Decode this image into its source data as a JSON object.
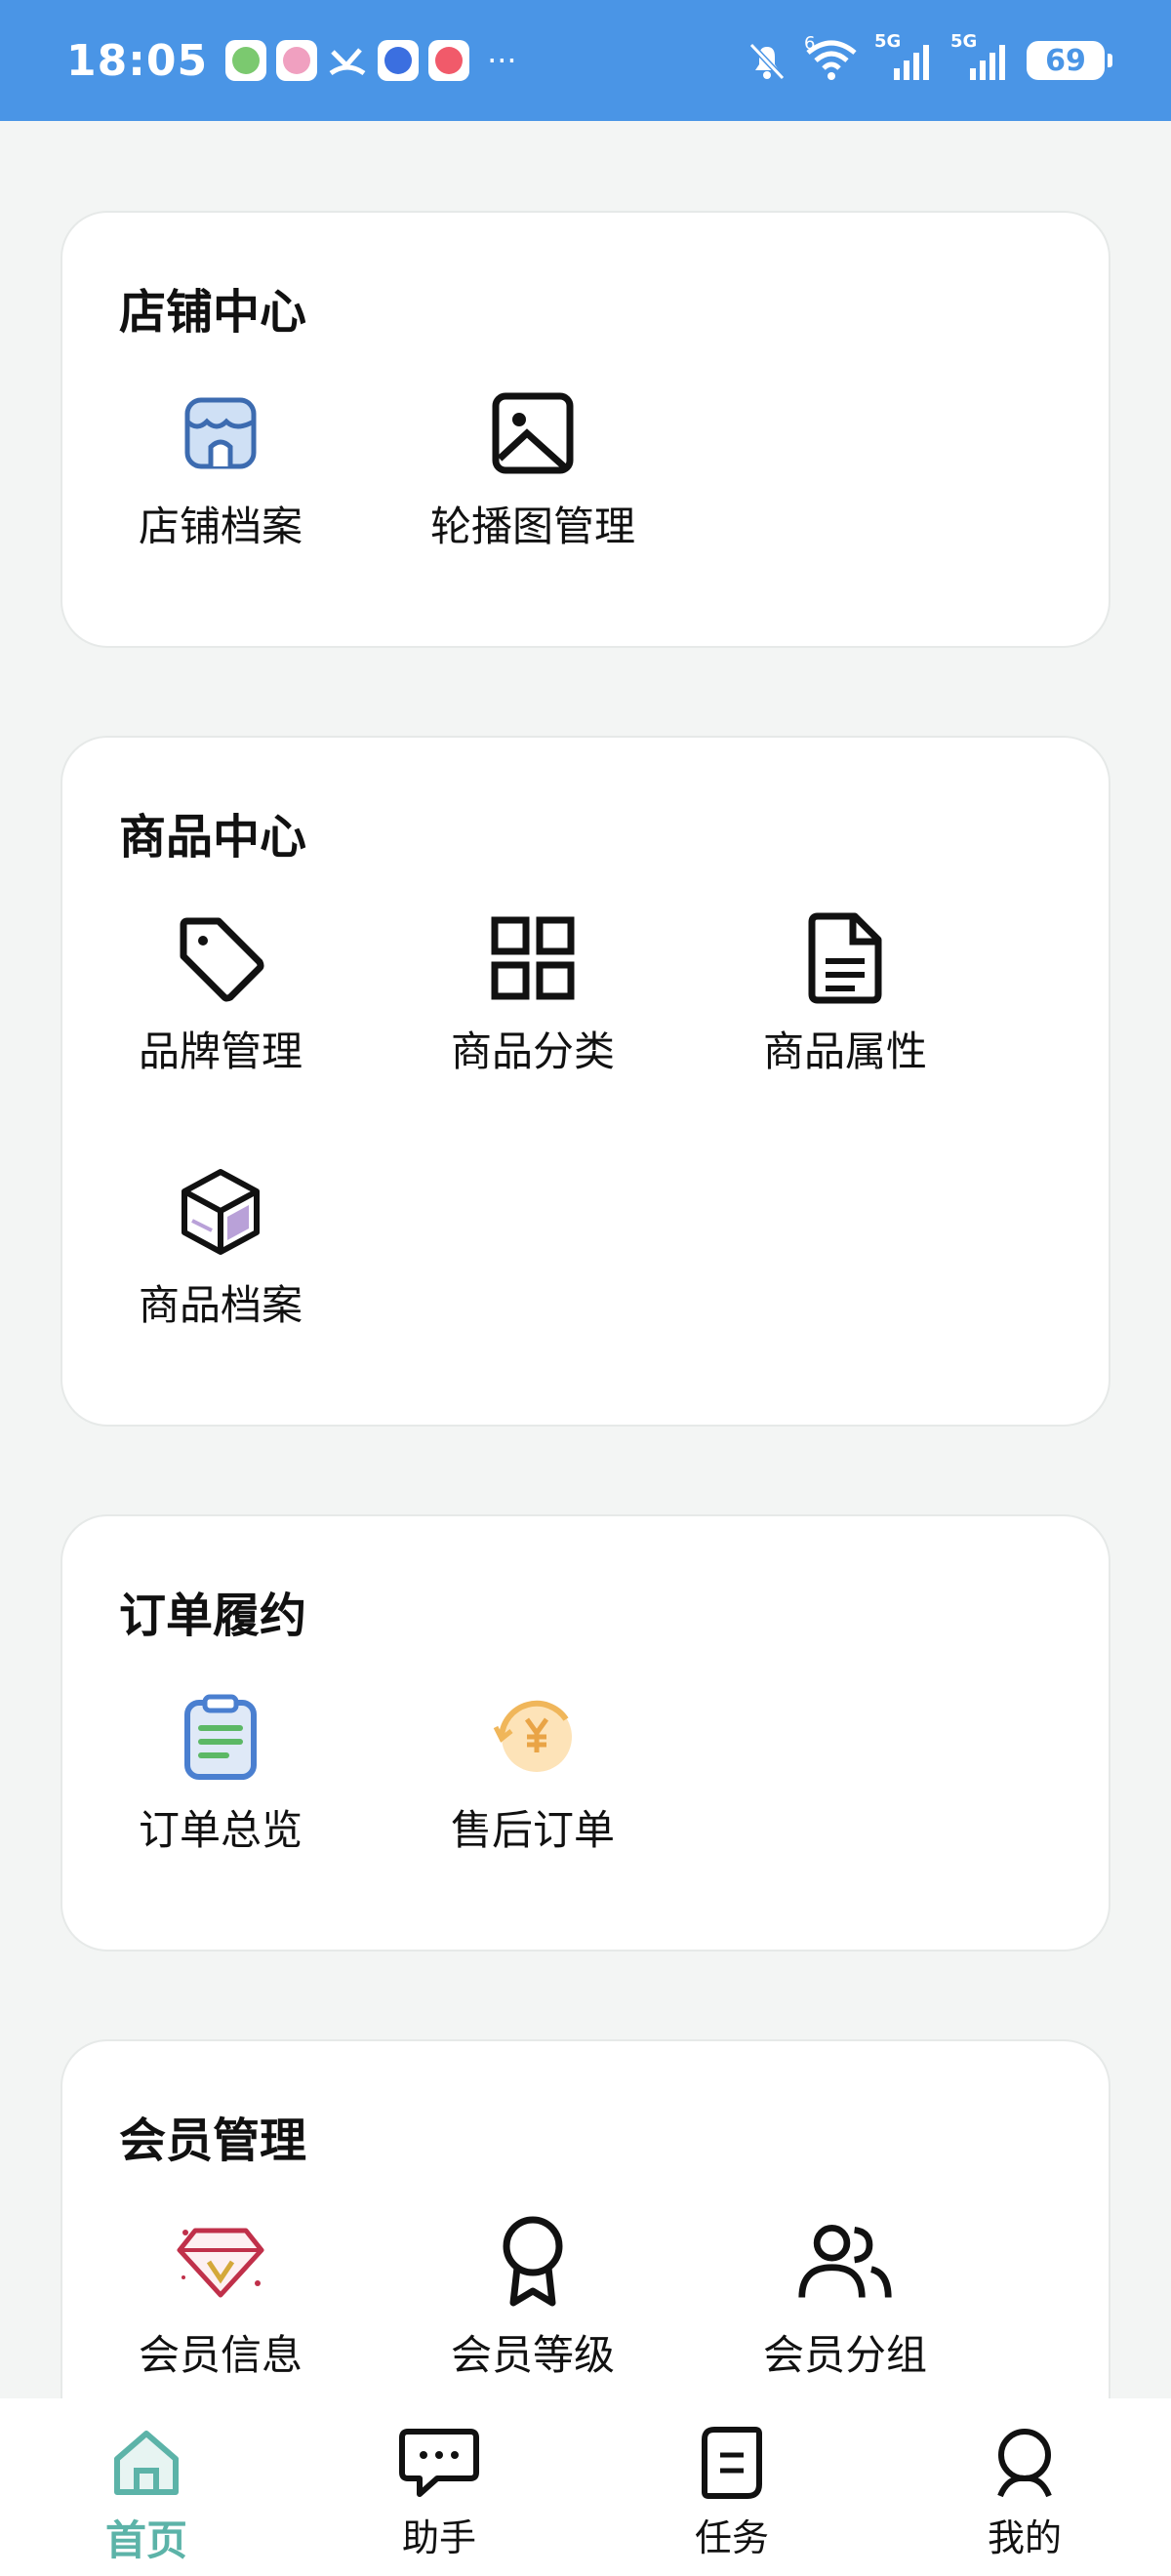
{
  "status_bar": {
    "time": "18:05",
    "more": "···",
    "battery": "69",
    "net_label_1": "5G",
    "net_label_2": "5G",
    "wifi_badge": "6"
  },
  "sections": {
    "store": {
      "title": "店铺中心",
      "items": [
        {
          "label": "店铺档案",
          "icon": "store-icon"
        },
        {
          "label": "轮播图管理",
          "icon": "image-icon"
        }
      ]
    },
    "goods": {
      "title": "商品中心",
      "items": [
        {
          "label": "品牌管理",
          "icon": "tag-icon"
        },
        {
          "label": "商品分类",
          "icon": "grid-icon"
        },
        {
          "label": "商品属性",
          "icon": "document-icon"
        },
        {
          "label": "商品档案",
          "icon": "box-icon"
        }
      ]
    },
    "order": {
      "title": "订单履约",
      "items": [
        {
          "label": "订单总览",
          "icon": "clipboard-icon"
        },
        {
          "label": "售后订单",
          "icon": "refund-yen-icon"
        }
      ]
    },
    "member": {
      "title": "会员管理",
      "items": [
        {
          "label": "会员信息",
          "icon": "diamond-icon"
        },
        {
          "label": "会员等级",
          "icon": "award-icon"
        },
        {
          "label": "会员分组",
          "icon": "users-icon"
        }
      ]
    }
  },
  "bottom_nav": {
    "items": [
      {
        "label": "首页",
        "icon": "home-icon",
        "active": true
      },
      {
        "label": "助手",
        "icon": "chat-icon"
      },
      {
        "label": "任务",
        "icon": "task-icon"
      },
      {
        "label": "我的",
        "icon": "user-icon"
      }
    ]
  },
  "colors": {
    "status_bar": "#4a95e6",
    "background": "#f3f5f4",
    "active_tab": "#5cb3a8"
  }
}
